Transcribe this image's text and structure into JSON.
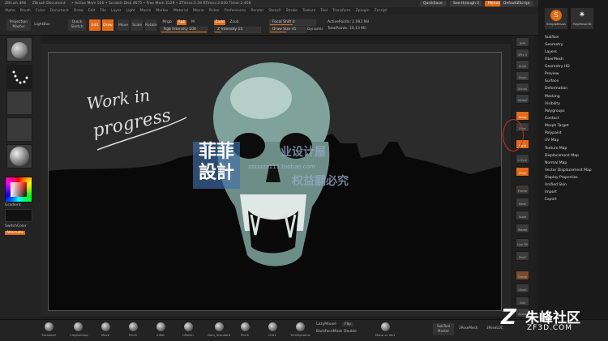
{
  "titlebar": {
    "app": "ZBrush 4R6",
    "document": "ZBrush Document",
    "stats": "• Active Mem 520 • Scratch Disk 4675 • Free Mem 3129 • ZTimes:5.59 RTimes:2.640 Timer:2.456",
    "quicksave": "QuickSave",
    "seethrough": "See-through  0",
    "menus_btn": "Menus",
    "script": "DefaultZScript"
  },
  "menubar": [
    "Alpha",
    "Brush",
    "Color",
    "Document",
    "Draw",
    "Edit",
    "File",
    "Layer",
    "Light",
    "Macro",
    "Marker",
    "Material",
    "Movie",
    "Picker",
    "Preferences",
    "Render",
    "Stencil",
    "Stroke",
    "Texture",
    "Tool",
    "Transform",
    "Zplugin",
    "Zscript"
  ],
  "shelf": {
    "projection_master": "Projection Master",
    "lightbox": "LightBox",
    "quick_sketch": "Quick Sketch",
    "edit": "Edit",
    "draw": "Draw",
    "move": "Move",
    "scale": "Scale",
    "rotate": "Rotate",
    "mrgb": "Mrgb",
    "rgb": "Rgb",
    "m": "M",
    "rgb_intensity": "Rgb Intensity 100",
    "zadd": "Zadd",
    "zsub": "Zsub",
    "z_intensity": "Z Intensity 15",
    "focal_shift": "Focal Shift 0",
    "draw_size": "Draw Size 45",
    "dynamic": "Dynamic",
    "active_points": "ActivePoints: 2.093 Mil",
    "total_points": "TotalPoints: 10.13 Mil"
  },
  "left": {
    "gradient": "Gradient",
    "switchcolor": "SwitchColor",
    "alternate": "Alternate"
  },
  "canvas": {
    "handwriting_line1": "Work in",
    "handwriting_line2": "progress",
    "watermark_title": "菲菲設計",
    "watermark_sub1": "业设计屋",
    "watermark_url": "zzzzzzz111.taobao.com",
    "watermark_sub2": "权益翻必究"
  },
  "rightstrip": [
    "BPR",
    "SPix 3",
    "Scroll",
    "Zoom",
    "Actual",
    "AAHalf",
    "Persp",
    "Floor",
    "Local",
    "L.Sym",
    "Gxyz",
    "Frame",
    "Move",
    "Scale",
    "Rotate",
    "Line Fill",
    "PolyF",
    "Transp",
    "Ghost",
    "Solo",
    "Xpose"
  ],
  "rightpanel": {
    "top_tools": [
      "SimpleBrush",
      "PolyMesh3D"
    ],
    "items": [
      "SubTool",
      "Geometry",
      "Layers",
      "FiberMesh",
      "Geometry HD",
      "Preview",
      "Surface",
      "Deformation",
      "Masking",
      "Visibility",
      "Polygroups",
      "Contact",
      "Morph Target",
      "Polypaint",
      "UV Map",
      "Texture Map",
      "Displacement Map",
      "Normal Map",
      "Vector Displacement Map",
      "Display Properties",
      "Unified Skin",
      "Import",
      "Export"
    ]
  },
  "bottom": {
    "brushes": [
      "Standard",
      "ClayBuildup",
      "Move",
      "Pinch",
      "Inflat",
      "hPolish",
      "Dam_Standard",
      "Pinch",
      "Orb1",
      "TrimDynamic"
    ],
    "lazymouse": "LazyMouse",
    "flip": "Flip",
    "backface": "BackfaceMask",
    "double": "Double",
    "mono": "Mono or Vert",
    "subtool_master": "SubTool Master",
    "zplugin1": "3PoseMesh",
    "zplugin2": "3PoseLOC"
  },
  "logo": {
    "glyph": "Z",
    "name": "朱峰社区",
    "url": "ZF3D.COM"
  },
  "colors": {
    "accent": "#e46a17",
    "background": "#262626",
    "skull": "#8fb4aa"
  }
}
